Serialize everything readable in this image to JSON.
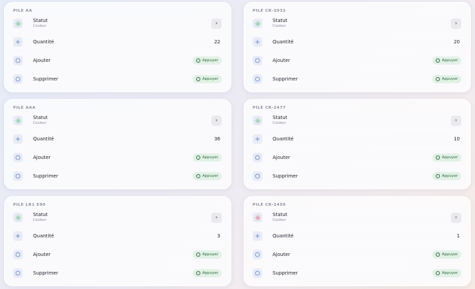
{
  "cards": [
    {
      "title": "PILE AA",
      "status_label": "Statut",
      "status_sub": "Couleur",
      "status_color": "#46b36a",
      "quantity_label": "Quantité",
      "quantity": "22",
      "add_label": "Ajouter",
      "remove_label": "Supprimer",
      "action_label": "Appuyer"
    },
    {
      "title": "PILE CR-2032",
      "status_label": "Statut",
      "status_sub": "Couleur",
      "status_color": "#46b36a",
      "quantity_label": "Quantité",
      "quantity": "20",
      "add_label": "Ajouter",
      "remove_label": "Supprimer",
      "action_label": "Appuyer"
    },
    {
      "title": "PILE AAA",
      "status_label": "Statut",
      "status_sub": "Couleur",
      "status_color": "#46b36a",
      "quantity_label": "Quantité",
      "quantity": "36",
      "add_label": "Ajouter",
      "remove_label": "Supprimer",
      "action_label": "Appuyer"
    },
    {
      "title": "PILE CR-2477",
      "status_label": "Statut",
      "status_sub": "Couleur",
      "status_color": "#46b36a",
      "quantity_label": "Quantité",
      "quantity": "10",
      "add_label": "Ajouter",
      "remove_label": "Supprimer",
      "action_label": "Appuyer"
    },
    {
      "title": "PILE LR1 E90",
      "status_label": "Statut",
      "status_sub": "Couleur",
      "status_color": "#46b36a",
      "quantity_label": "Quantité",
      "quantity": "3",
      "add_label": "Ajouter",
      "remove_label": "Supprimer",
      "action_label": "Appuyer"
    },
    {
      "title": "PILE CR-2450",
      "status_label": "Statut",
      "status_sub": "Couleur",
      "status_color": "#e0455c",
      "quantity_label": "Quantité",
      "quantity": "1",
      "add_label": "Ajouter",
      "remove_label": "Supprimer",
      "action_label": "Appuyer"
    }
  ],
  "icons": {
    "status": "sun-icon",
    "quantity": "plus-icon",
    "add": "circle-icon",
    "remove": "circle-icon",
    "open": "chevron-right-icon",
    "action": "ring-icon"
  },
  "colors": {
    "icon_blue": "#5a7ec9",
    "pill_bg": "#e2f1e6",
    "pill_text": "#2e6a40"
  }
}
